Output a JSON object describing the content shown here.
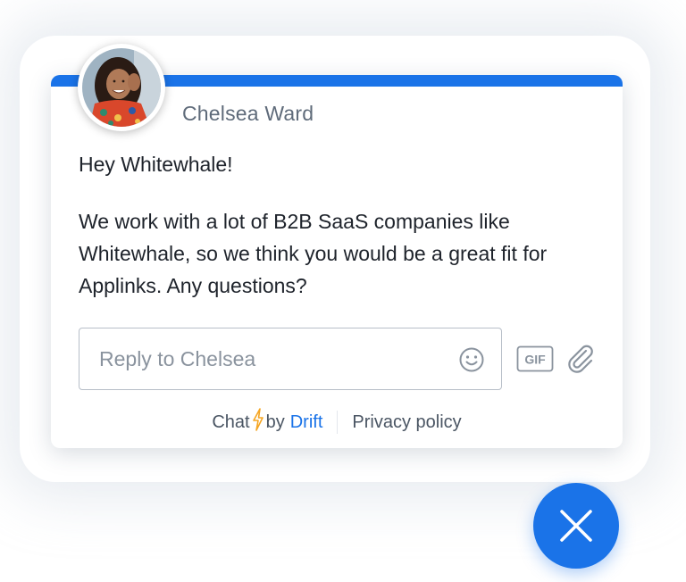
{
  "widget": {
    "sender_name": "Chelsea Ward",
    "avatar_icon": "avatar-photo"
  },
  "message": {
    "greeting": "Hey Whitewhale!",
    "body": "We work with a lot of B2B SaaS companies like Whitewhale, so we think you would be a great fit for Applinks. Any questions?"
  },
  "reply": {
    "placeholder": "Reply to Chelsea",
    "value": "",
    "emoji_icon": "smiley-icon",
    "gif_label": "GIF",
    "attach_icon": "paperclip-icon"
  },
  "footer": {
    "chat_label": "Chat",
    "by_label": "by",
    "brand_label": "Drift",
    "privacy_label": "Privacy policy"
  },
  "close": {
    "icon": "close-icon"
  },
  "colors": {
    "accent": "#1a73e8",
    "text": "#1e232b",
    "muted": "#5f6b7a",
    "bolt": "#f5a623"
  }
}
